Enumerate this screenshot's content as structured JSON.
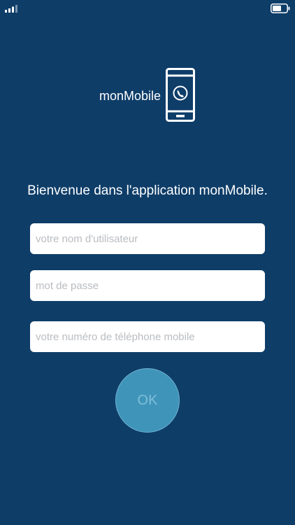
{
  "logo": {
    "app_name": "monMobile",
    "icon": "smartphone-call-icon"
  },
  "welcome": {
    "text": "Bienvenue dans l'application monMobile."
  },
  "form": {
    "username_placeholder": "votre nom d'utilisateur",
    "username_value": "",
    "password_placeholder": "mot de passe",
    "password_value": "",
    "phone_placeholder": "votre numéro de téléphone mobile",
    "phone_value": "",
    "ok_label": "OK"
  },
  "status_bar": {
    "signal_icon": "cellular-signal-icon",
    "battery_icon": "battery-icon"
  },
  "colors": {
    "background": "#0e3d68",
    "button_fill": "#3f94b9",
    "button_text": "#7fbedb",
    "field_background": "#ffffff",
    "placeholder_text": "#b9bcc0"
  }
}
